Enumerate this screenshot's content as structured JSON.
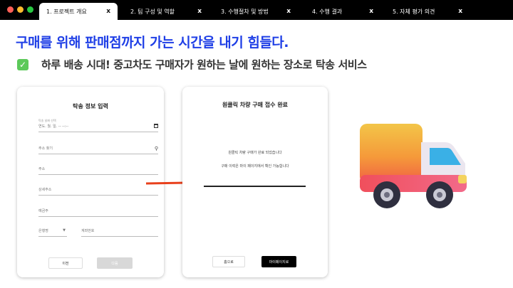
{
  "window": {
    "dot_colors": [
      "#ff5f57",
      "#febc2e",
      "#28c840"
    ]
  },
  "tabs": [
    {
      "label": "1. 프로젝트 개요",
      "close": "x",
      "active": true
    },
    {
      "label": "2. 팀 구성 및 역할",
      "close": "x",
      "active": false
    },
    {
      "label": "3. 수행절차 및 방법",
      "close": "x",
      "active": false
    },
    {
      "label": "4. 수행 결과",
      "close": "x",
      "active": false
    },
    {
      "label": "5. 자체 평가 의견",
      "close": "x",
      "active": false
    }
  ],
  "headline": "구매를 위해 판매점까지 가는 시간을 내기 힘들다.",
  "subheadline": {
    "icon": "check-mark-icon",
    "text": "하루 배송 시대! 중고차도 구매자가 원하는 날에 원하는 장소로 탁송 서비스"
  },
  "form_card": {
    "title": "탁송 정보 입력",
    "date_label": "탁송 날짜 선택",
    "date_placeholder": "연도. 월. 일. -- --:--",
    "address_search_placeholder": "주소 찾기",
    "address_placeholder": "주소",
    "detail_address_placeholder": "상세주소",
    "depositor_placeholder": "예금주",
    "bank_placeholder": "은행명",
    "account_placeholder": "계좌번호",
    "prev_button": "이전",
    "next_button": "다음"
  },
  "complete_card": {
    "title": "원클릭 차량 구매 접수 완료",
    "message1": "원클릭 차량 구매가 완료 되었습니다",
    "message2": "구매 이력은 마이 페이지에서 확인 가능합니다",
    "home_button": "홈으로",
    "mypage_button": "마이페이지로"
  },
  "icons": {
    "arrow": "arrow-right-icon",
    "truck": "delivery-truck-icon"
  },
  "colors": {
    "headline": "#1f3fe6",
    "arrow": "#e8401c",
    "check": "#5cc95a"
  }
}
